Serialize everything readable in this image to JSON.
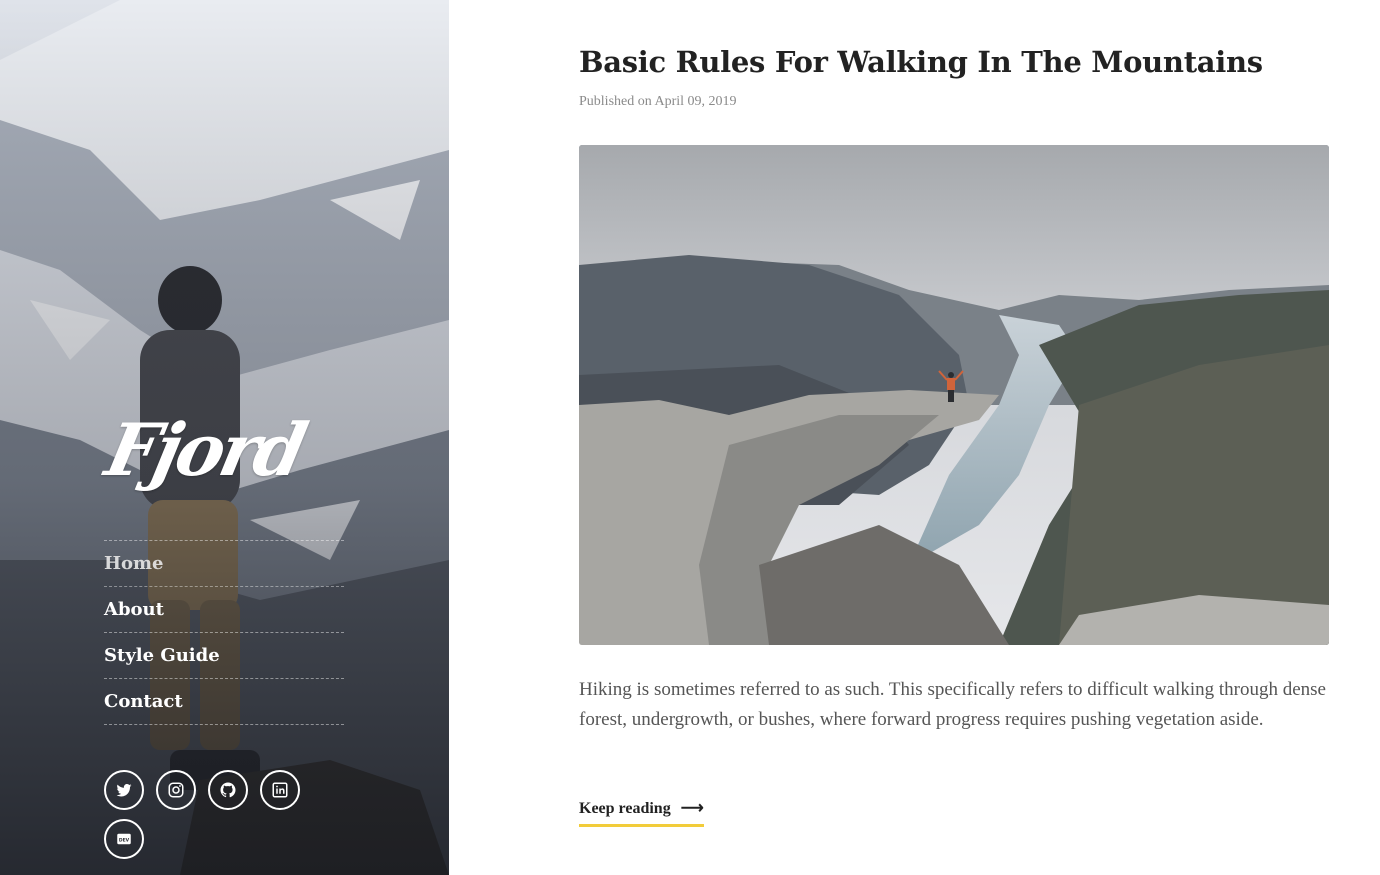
{
  "site": {
    "logo_text": "Fjord"
  },
  "nav": {
    "items": [
      {
        "label": "Home",
        "active": true
      },
      {
        "label": "About",
        "active": false
      },
      {
        "label": "Style Guide",
        "active": false
      },
      {
        "label": "Contact",
        "active": false
      }
    ]
  },
  "social": {
    "items": [
      {
        "name": "twitter-icon"
      },
      {
        "name": "instagram-icon"
      },
      {
        "name": "github-icon"
      },
      {
        "name": "linkedin-icon"
      },
      {
        "name": "dev-icon",
        "label": "DEV"
      }
    ]
  },
  "post": {
    "title": "Basic Rules For Walking In The Mountains",
    "meta": "Published on April 09, 2019",
    "excerpt": "Hiking is sometimes referred to as such. This specifically refers to difficult walking through dense forest, undergrowth, or bushes, where forward progress requires pushing vegetation aside.",
    "keep_reading": "Keep reading",
    "arrow": "⟶"
  },
  "colors": {
    "accent": "#f2cc3a",
    "title": "#222222",
    "meta": "#8a8a8a",
    "body_text": "#555555"
  }
}
